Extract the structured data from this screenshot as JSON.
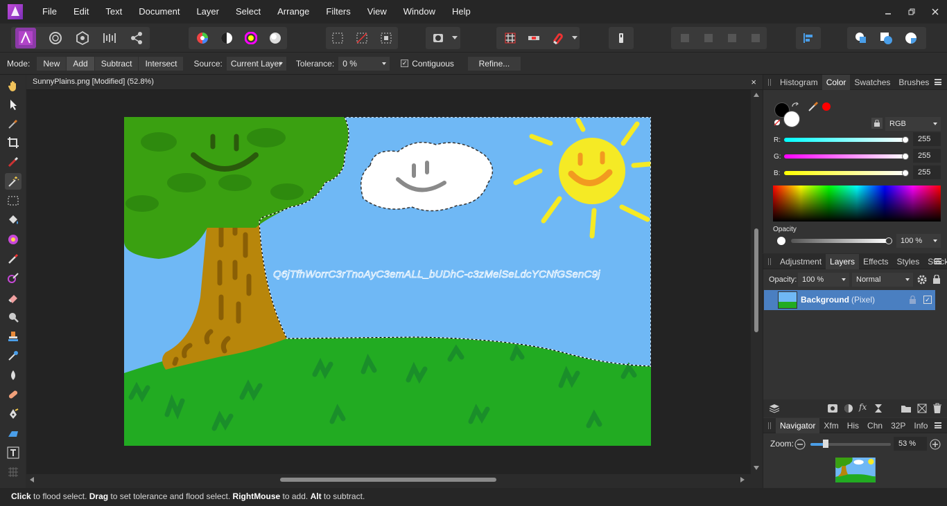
{
  "menubar": {
    "items": [
      "File",
      "Edit",
      "Text",
      "Document",
      "Layer",
      "Select",
      "Arrange",
      "Filters",
      "View",
      "Window",
      "Help"
    ],
    "window_controls": [
      "minimize-icon",
      "restore-icon",
      "close-icon"
    ]
  },
  "toolbar": {
    "icons": [
      "persona-photo-icon",
      "persona-liquify-icon",
      "persona-develop-icon",
      "persona-tone-map-icon",
      "persona-export-icon",
      "color-wheel-icon",
      "contrast-icon",
      "hsl-icon",
      "white-balance-icon",
      "select-all-icon",
      "deselect-icon",
      "invert-selection-icon",
      "quick-mask-icon",
      "mask-dropdown-icon",
      "snapping-grid-icon",
      "snapping-icon",
      "magnet-icon",
      "assistant-icon",
      "arrange-icons",
      "align-icon",
      "boolean-add-icon",
      "boolean-subtract-icon",
      "boolean-intersect-icon"
    ]
  },
  "context": {
    "mode_label": "Mode:",
    "modes": [
      "New",
      "Add",
      "Subtract",
      "Intersect"
    ],
    "active_mode": "Add",
    "source_label": "Source:",
    "source_value": "Current Layer",
    "tolerance_label": "Tolerance:",
    "tolerance_value": "0 %",
    "contiguous_label": "Contiguous",
    "contiguous_checked": true,
    "refine_label": "Refine..."
  },
  "document": {
    "title": "SunnyPlains.png [Modified] (52.8%)",
    "close_glyph": "×",
    "artboard_text": "Q6jTfhWorrC3rTnoAyC3emALL_bUDhC-c3zMelSeLdcYCNfGSenC9j"
  },
  "tools": {
    "items": [
      "hand-icon",
      "move-icon",
      "color-picker-icon",
      "crop-icon",
      "selection-brush-icon",
      "flood-select-icon",
      "rectangular-marquee-icon",
      "flood-fill-icon",
      "gradient-icon",
      "paint-brush-icon",
      "color-replace-icon",
      "erase-brush-icon",
      "dodge-icon",
      "clone-icon",
      "retouch-icon",
      "blur-icon",
      "healing-icon",
      "pen-icon",
      "shape-icon",
      "text-icon",
      "mesh-warp-icon"
    ],
    "active": "flood-select-icon"
  },
  "status": {
    "click": "Click",
    "t1": " to flood select. ",
    "drag": "Drag",
    "t2": " to set tolerance and flood select. ",
    "rightmouse": "RightMouse",
    "t3": " to add. ",
    "alt": "Alt",
    "t4": " to subtract."
  },
  "color_panel": {
    "tabs": [
      "Histogram",
      "Color",
      "Swatches",
      "Brushes"
    ],
    "active_tab": "Color",
    "model": "RGB",
    "r_label": "R:",
    "r_value": "255",
    "g_label": "G:",
    "g_value": "255",
    "b_label": "B:",
    "b_value": "255",
    "opacity_label": "Opacity",
    "opacity_value": "100 %",
    "swatch_accent": "#ff0000"
  },
  "layers_panel": {
    "tabs": [
      "Adjustment",
      "Layers",
      "Effects",
      "Styles",
      "Stock"
    ],
    "active_tab": "Layers",
    "opacity_label": "Opacity:",
    "opacity_value": "100 %",
    "blend_mode": "Normal",
    "layers": [
      {
        "name": "Background",
        "type": "(Pixel)",
        "visible": true
      }
    ]
  },
  "navigator_panel": {
    "tabs": [
      "Navigator",
      "Xfm",
      "His",
      "Chn",
      "32P",
      "Info"
    ],
    "active_tab": "Navigator",
    "zoom_label": "Zoom:",
    "zoom_value": "53 %"
  }
}
